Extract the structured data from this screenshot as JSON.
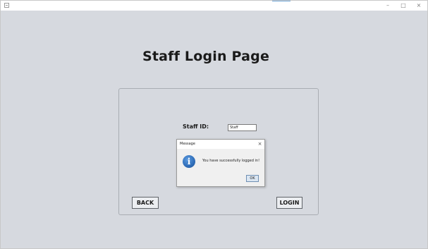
{
  "window": {
    "icon": "app-window-icon",
    "controls": {
      "minimize": "–",
      "maximize": "□",
      "close": "×"
    }
  },
  "page": {
    "title": "Staff Login Page"
  },
  "form": {
    "staff_id_label": "Staff ID:",
    "staff_id_value": "Staff",
    "back_label": "BACK",
    "login_label": "LOGIN"
  },
  "dialog": {
    "title": "Message",
    "close": "×",
    "icon": "info-icon",
    "icon_glyph": "i",
    "message": "You have successfully logged in!",
    "ok_label": "OK"
  },
  "colors": {
    "background": "#d6d9df",
    "dialog_background": "#f0f0f0",
    "info_icon": "#2f6db8"
  }
}
